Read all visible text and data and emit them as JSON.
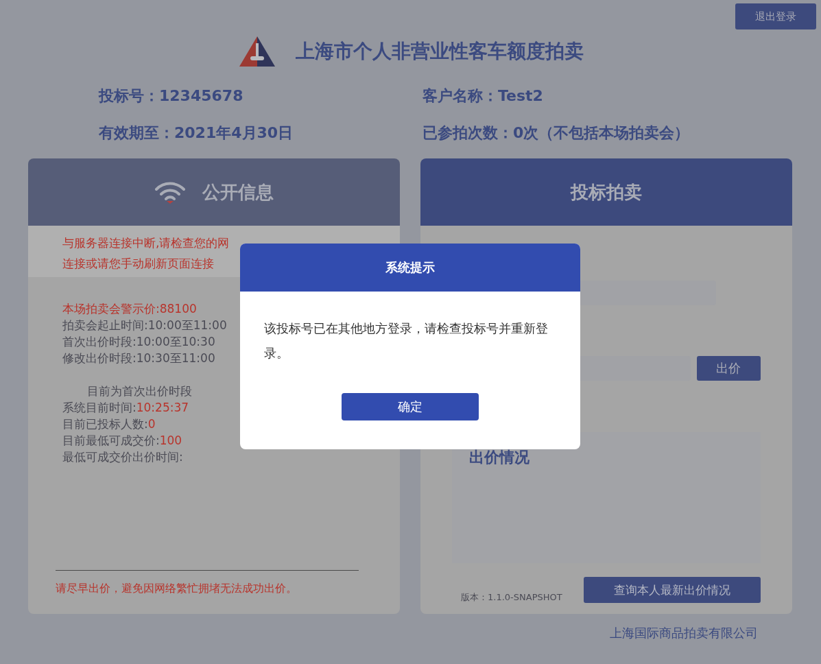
{
  "logout_button": "退出登录",
  "header": {
    "title": "上海市个人非营业性客车额度拍卖"
  },
  "bidder_info": [
    "投标号：12345678",
    "客户名称：Test2",
    "有效期至：2021年4月30日",
    "已参拍次数：0次（不包括本场拍卖会）"
  ],
  "public_panel": {
    "title": "公开信息",
    "connection_alert": [
      "与服务器连接中断,请检查您的网",
      "连接或请您手动刷新页面连接"
    ],
    "lines": [
      {
        "kind": "warning",
        "label": "本场拍卖会警示价:88100"
      },
      {
        "kind": "plain",
        "label": "拍卖会起止时间:10:00至11:00"
      },
      {
        "kind": "plain",
        "label": "首次出价时段:10:00至10:30"
      },
      {
        "kind": "plain",
        "label": "修改出价时段:10:30至11:00"
      },
      {
        "kind": "indented",
        "label": "目前为首次出价时段"
      },
      {
        "kind": "pair",
        "label": "系统目前时间:",
        "value": "10:25:37"
      },
      {
        "kind": "pair",
        "label": "目前已投标人数:",
        "value": "0"
      },
      {
        "kind": "pair",
        "label": "目前最低可成交价:",
        "value": "100"
      },
      {
        "kind": "plain",
        "label": "最低可成交价出价时间:"
      }
    ],
    "footer_note": "请尽早出价，避免因网络繁忙拥堵无法成功出价。"
  },
  "bid_panel": {
    "title": "投标拍卖",
    "bid_button": "出价",
    "bid_status_title": "出价情况",
    "version": "版本：1.1.0-SNAPSHOT",
    "query_button": "查询本人最新出价情况"
  },
  "dialog": {
    "title": "系统提示",
    "message": "该投标号已在其他地方登录，请检查投标号并重新登录。",
    "confirm_button": "确定"
  },
  "company": "上海国际商品拍卖有限公司"
}
